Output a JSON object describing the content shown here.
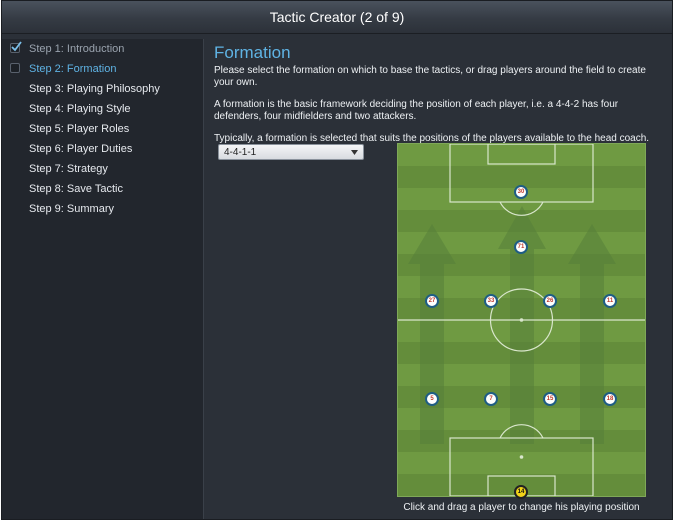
{
  "window": {
    "title": "Tactic Creator (2 of 9)"
  },
  "sidebar": {
    "steps": [
      {
        "label": "Step 1: Introduction",
        "state": "done"
      },
      {
        "label": "Step 2: Formation",
        "state": "current"
      },
      {
        "label": "Step 3: Playing Philosophy",
        "state": "todo"
      },
      {
        "label": "Step 4: Playing Style",
        "state": "todo"
      },
      {
        "label": "Step 5: Player Roles",
        "state": "todo"
      },
      {
        "label": "Step 6: Player Duties",
        "state": "todo"
      },
      {
        "label": "Step 7: Strategy",
        "state": "todo"
      },
      {
        "label": "Step 8: Save Tactic",
        "state": "todo"
      },
      {
        "label": "Step 9: Summary",
        "state": "todo"
      }
    ]
  },
  "main": {
    "heading": "Formation",
    "intro": "Please select the formation on which to base the tactics, or drag players around the field to create your own.",
    "explanation": "A formation is the basic framework deciding the position of each player, i.e. a 4-4-2 has four defenders, four midfielders and two attackers.",
    "hint": "Typically, a formation is selected that suits the positions of the players available to the head coach.",
    "formation_select": {
      "value": "4-4-1-1"
    },
    "pitch_caption": "Click and drag a player to change his playing position",
    "players": [
      {
        "number": "30",
        "role": "striker"
      },
      {
        "number": "71",
        "role": "attacking-midfielder"
      },
      {
        "number": "27",
        "role": "left-midfielder"
      },
      {
        "number": "33",
        "role": "central-midfielder"
      },
      {
        "number": "26",
        "role": "central-midfielder"
      },
      {
        "number": "11",
        "role": "right-midfielder"
      },
      {
        "number": "5",
        "role": "left-back"
      },
      {
        "number": "7",
        "role": "centre-back"
      },
      {
        "number": "15",
        "role": "centre-back"
      },
      {
        "number": "18",
        "role": "right-back"
      },
      {
        "number": "14",
        "role": "goalkeeper"
      }
    ]
  },
  "colors": {
    "accent": "#5fb3e4",
    "pitch_green": "#6f9a42",
    "goalkeeper": "#f2d318",
    "player_ring": "#1f5d84",
    "player_number": "#c0392b"
  }
}
